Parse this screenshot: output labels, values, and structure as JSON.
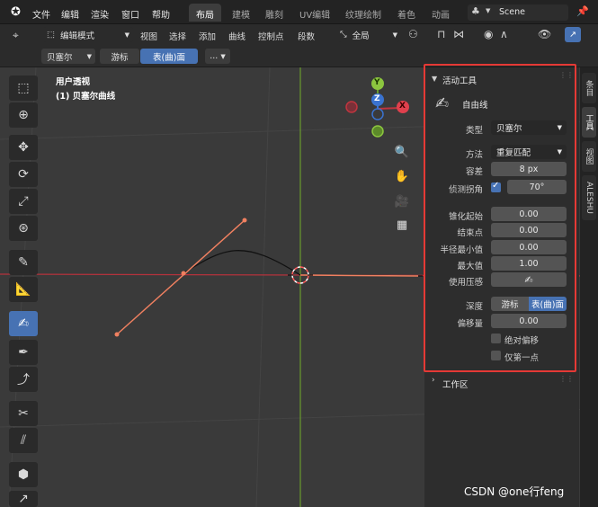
{
  "menubar": {
    "items": [
      "文件",
      "编辑",
      "渲染",
      "窗口",
      "帮助"
    ],
    "workspaces": [
      "布局",
      "建模",
      "雕刻",
      "UV编辑",
      "纹理绘制",
      "着色",
      "动画"
    ],
    "active_workspace": "布局",
    "scene": "Scene"
  },
  "header": {
    "mode": "编辑模式",
    "menus": [
      "视图",
      "选择",
      "添加",
      "曲线",
      "控制点",
      "段数"
    ],
    "orientation": "全局"
  },
  "tool_header": {
    "curve_type": "贝塞尔",
    "depth_options": [
      "游标",
      "表(曲)面"
    ],
    "active_depth": "表(曲)面",
    "more": "..."
  },
  "viewport": {
    "view_name": "用户透视",
    "object_name": "(1) 贝塞尔曲线",
    "gizmo_labels": {
      "y": "Y",
      "z": "Z",
      "x": "X"
    }
  },
  "npanel": {
    "section_title": "活动工具",
    "tool_name": "自由线",
    "type_label": "类型",
    "type_value": "贝塞尔",
    "method_label": "方法",
    "method_value": "重复匹配",
    "tolerance_label": "容差",
    "tolerance_value": "8 px",
    "corner_label": "侦测拐角",
    "corner_value": "70°",
    "corner_checked": true,
    "taper_start_label": "锥化起始",
    "taper_start_value": "0.00",
    "taper_end_label": "结束点",
    "taper_end_value": "0.00",
    "radius_min_label": "半径最小值",
    "radius_min_value": "0.00",
    "radius_max_label": "最大值",
    "radius_max_value": "1.00",
    "pressure_label": "使用压感",
    "depth_label": "深度",
    "depth_options": [
      "游标",
      "表(曲)面"
    ],
    "depth_active": "表(曲)面",
    "offset_label": "偏移量",
    "offset_value": "0.00",
    "absolute_offset_label": "绝对偏移",
    "absolute_offset_checked": false,
    "first_only_label": "仅第一点",
    "first_only_checked": false,
    "workspace_section": "工作区"
  },
  "side_tabs": [
    "条目",
    "工具",
    "视图",
    "ALESHU"
  ],
  "active_side_tab": "工具",
  "watermark": "CSDN @one行feng",
  "colors": {
    "accent": "#4772b3",
    "highlight_border": "#e53935",
    "curve_handle": "#f08060",
    "axis_x": "#c0353f",
    "axis_y": "#6a9b2e"
  }
}
